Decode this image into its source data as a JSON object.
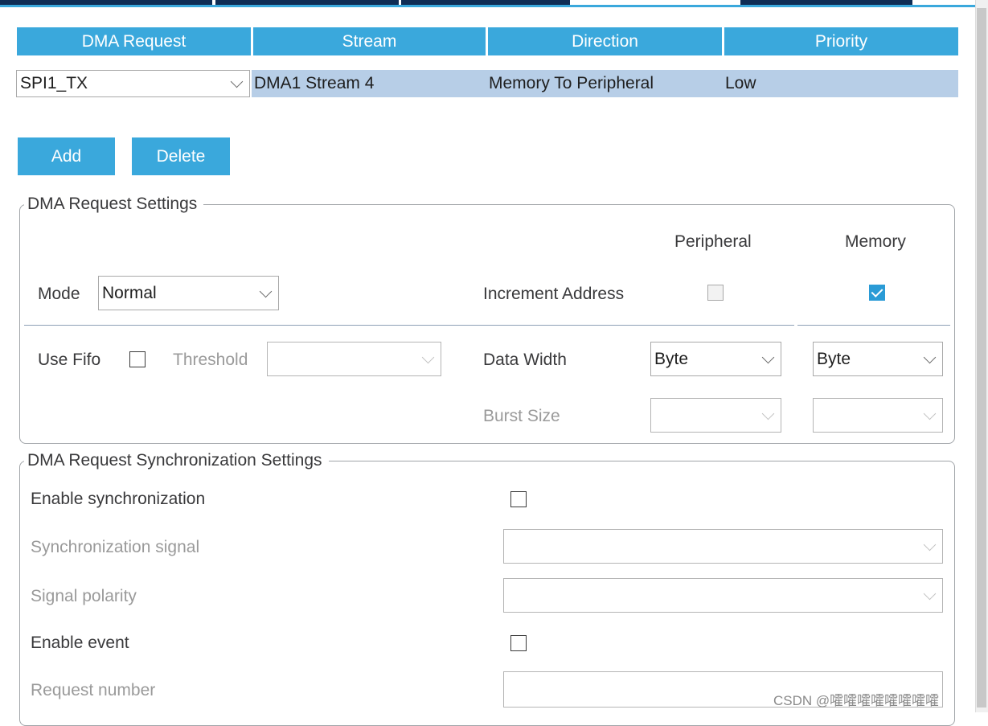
{
  "table": {
    "headers": [
      "DMA Request",
      "Stream",
      "Direction",
      "Priority"
    ],
    "row": {
      "request": "SPI1_TX",
      "stream": "DMA1 Stream 4",
      "direction": "Memory To Peripheral",
      "priority": "Low"
    }
  },
  "buttons": {
    "add": "Add",
    "delete": "Delete"
  },
  "request_settings": {
    "title": "DMA Request Settings",
    "col_peripheral": "Peripheral",
    "col_memory": "Memory",
    "mode_label": "Mode",
    "mode_value": "Normal",
    "increment_label": "Increment Address",
    "increment_peripheral_checked": false,
    "increment_memory_checked": true,
    "fifo_label": "Use Fifo",
    "threshold_label": "Threshold",
    "threshold_value": "",
    "data_width_label": "Data Width",
    "data_width_peripheral": "Byte",
    "data_width_memory": "Byte",
    "burst_label": "Burst Size"
  },
  "sync_settings": {
    "title": "DMA Request Synchronization Settings",
    "enable_sync_label": "Enable synchronization",
    "sync_signal_label": "Synchronization signal",
    "signal_polarity_label": "Signal polarity",
    "enable_event_label": "Enable event",
    "request_number_label": "Request number"
  },
  "watermark": "CSDN @嚯嚯嚯嚯嚯嚯嚯嚯",
  "colors": {
    "accent": "#3aa8dc",
    "row_selected": "#b7cee7",
    "dark_tab": "#0f2d55",
    "checked": "#2a9bd6"
  }
}
